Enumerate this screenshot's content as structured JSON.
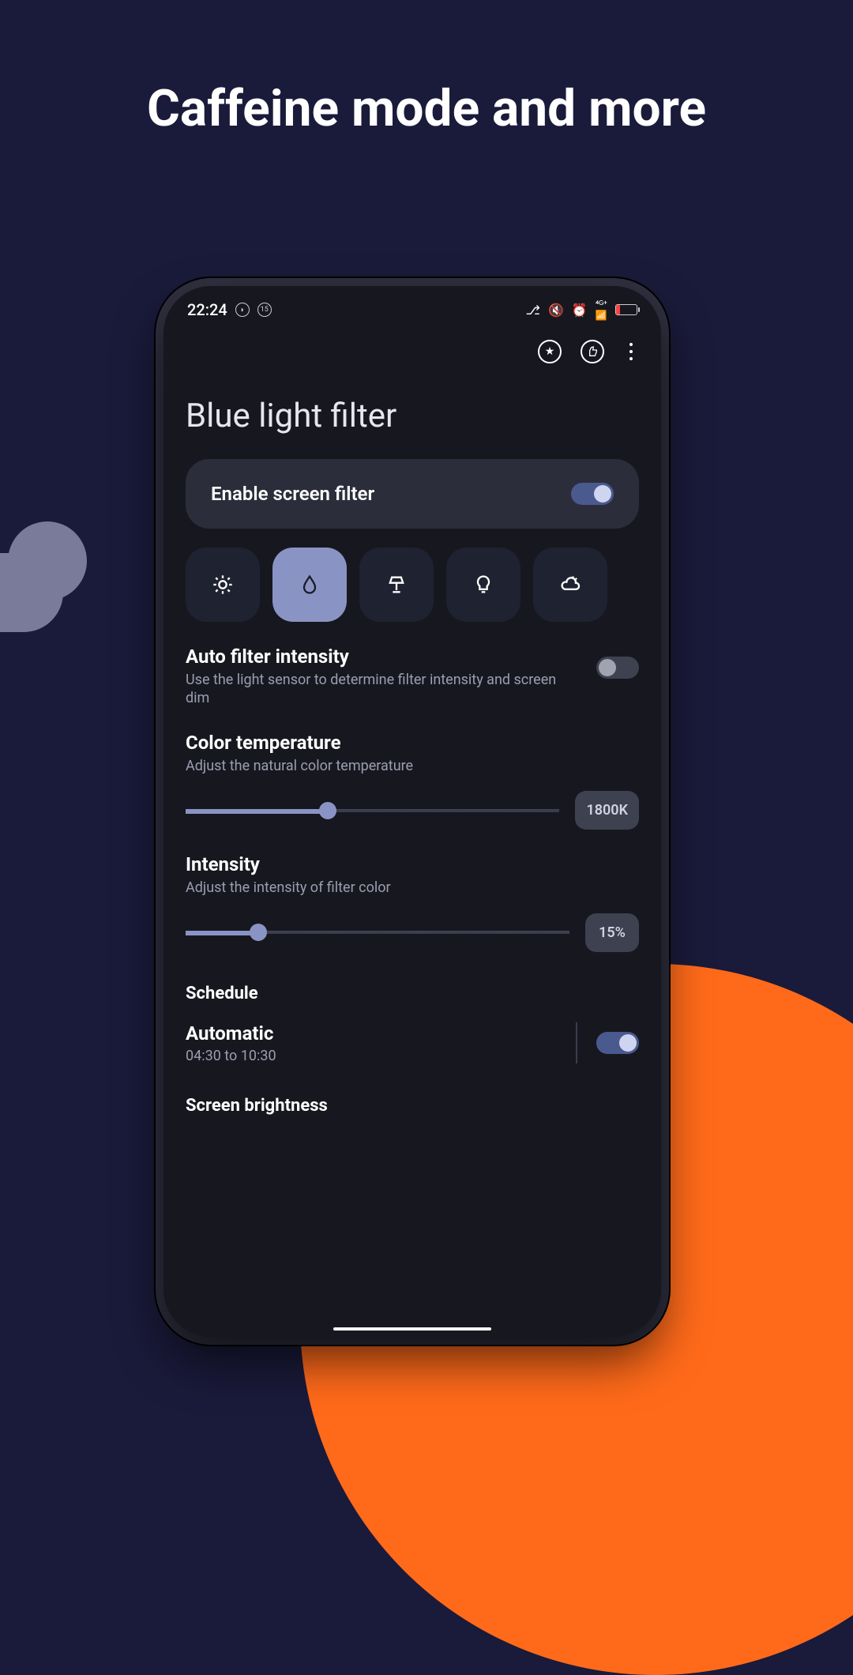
{
  "headline": "Caffeine mode and more",
  "status": {
    "time": "22:24"
  },
  "page": {
    "title": "Blue light filter"
  },
  "enable_filter": {
    "label": "Enable screen filter",
    "on": true
  },
  "preset_icons": [
    "sun",
    "drop",
    "lamp",
    "bulb",
    "cloud"
  ],
  "auto_intensity": {
    "title": "Auto filter intensity",
    "desc": "Use the light sensor to determine filter intensity and screen dim",
    "on": false
  },
  "color_temp": {
    "title": "Color temperature",
    "desc": "Adjust the natural color temperature",
    "value_label": "1800K",
    "percent": 38
  },
  "intensity": {
    "title": "Intensity",
    "desc": "Adjust the intensity of filter color",
    "value_label": "15%",
    "percent": 19
  },
  "schedule_header": "Schedule",
  "automatic": {
    "title": "Automatic",
    "subtitle": "04:30 to 10:30",
    "on": true
  },
  "brightness_header": "Screen brightness"
}
